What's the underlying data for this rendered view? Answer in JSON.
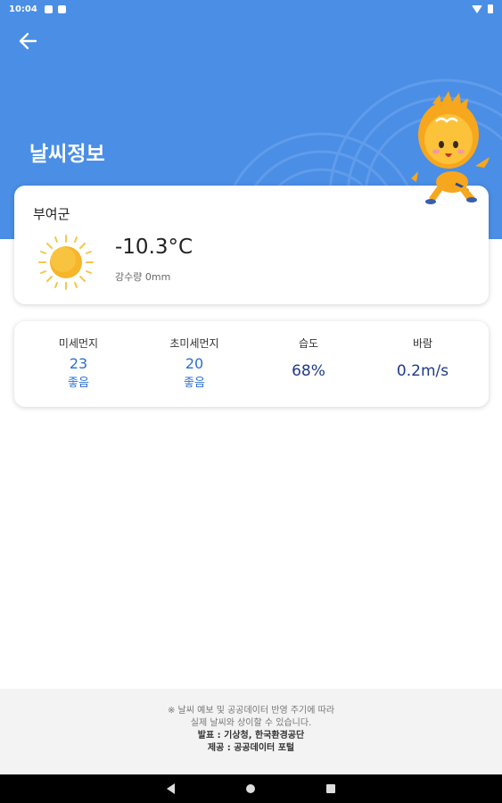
{
  "status_bar": {
    "time": "10:04",
    "icons": [
      "notification-icon",
      "sd-card-icon",
      "wifi-icon",
      "battery-icon"
    ]
  },
  "header": {
    "title": "날씨정보",
    "back_icon": "back-arrow-icon",
    "background_color": "#4a8ee6"
  },
  "weather": {
    "region": "부여군",
    "condition_icon": "sun-icon",
    "temperature": "-10.3°C",
    "precipitation": "강수량 0mm"
  },
  "stats": {
    "fine_dust": {
      "label": "미세먼지",
      "value": "23",
      "grade": "좋음"
    },
    "ultra_fine_dust": {
      "label": "초미세먼지",
      "value": "20",
      "grade": "좋음"
    },
    "humidity": {
      "label": "습도",
      "value": "68%"
    },
    "wind": {
      "label": "바람",
      "value": "0.2m/s"
    }
  },
  "footer": {
    "note_line1": "※ 날씨 예보 및 공공데이터 반영 주기에 따라",
    "note_line2": "실제 날씨와 상이할 수 있습니다.",
    "source": "발표 : 기상청, 한국환경공단",
    "provider": "제공 : 공공데이터 포털"
  },
  "colors": {
    "accent": "#2b6fd0",
    "value_dark": "#1f3a8a",
    "sun": "#f5b62a"
  }
}
